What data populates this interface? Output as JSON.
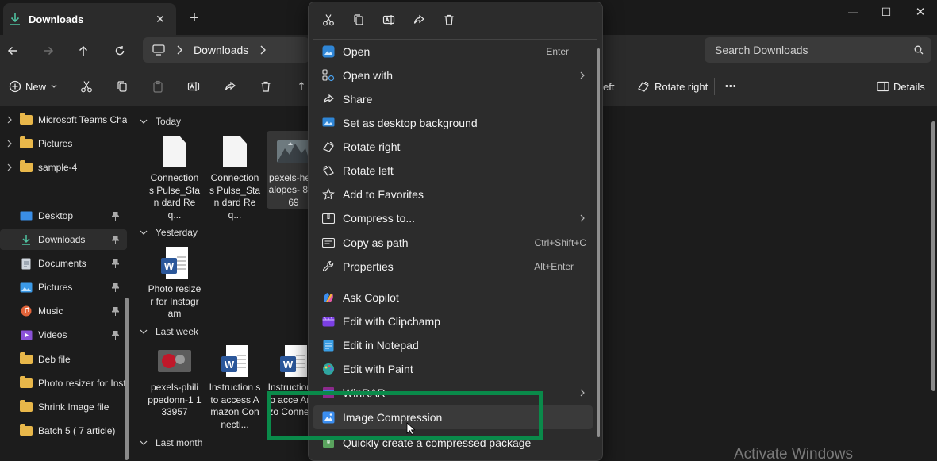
{
  "tab": {
    "title": "Downloads",
    "close": "✕",
    "new": "+"
  },
  "window_controls": {
    "minimize": "—",
    "maximize": "☐",
    "close": "✕"
  },
  "nav": {
    "breadcrumb": "Downloads",
    "search_placeholder": "Search Downloads"
  },
  "cmdbar": {
    "new_label": "New",
    "rotate_left_partial": "eft",
    "rotate_right_label": "Rotate right",
    "more_label": "•••",
    "details_label": "Details"
  },
  "sidebar": {
    "tree": [
      {
        "label": "Microsoft Teams Cha"
      },
      {
        "label": "Pictures"
      },
      {
        "label": "sample-4"
      }
    ],
    "quick": [
      {
        "label": "Desktop",
        "icon": "desktop-icon",
        "pinned": true
      },
      {
        "label": "Downloads",
        "icon": "download-icon",
        "pinned": true,
        "selected": true
      },
      {
        "label": "Documents",
        "icon": "documents-icon",
        "pinned": true
      },
      {
        "label": "Pictures",
        "icon": "pictures-icon",
        "pinned": true
      },
      {
        "label": "Music",
        "icon": "music-icon",
        "pinned": true
      },
      {
        "label": "Videos",
        "icon": "videos-icon",
        "pinned": true
      },
      {
        "label": "Deb file",
        "icon": "folder-icon",
        "pinned": false
      },
      {
        "label": "Photo resizer for Instag",
        "icon": "folder-icon",
        "pinned": false
      },
      {
        "label": "Shrink Image file",
        "icon": "folder-icon",
        "pinned": false
      },
      {
        "label": "Batch 5 ( 7 article)",
        "icon": "folder-icon",
        "pinned": false
      }
    ]
  },
  "groups": {
    "today": "Today",
    "yesterday": "Yesterday",
    "last_week": "Last week",
    "last_month": "Last month"
  },
  "files": {
    "today": [
      {
        "name": "Connection s Pulse_Stan dard Req..."
      },
      {
        "name": "Connection s Pulse_Stan dard Req..."
      },
      {
        "name": "pexels-he nalopes- 88069"
      }
    ],
    "yesterday": [
      {
        "name": "Photo resizer for Instagram"
      }
    ],
    "last_week": [
      {
        "name": "pexels-phili ppedonn-1 133957"
      },
      {
        "name": "Instruction s to access Amazon Connecti..."
      },
      {
        "name": "Instruction s to acce Amazo Connecti"
      }
    ]
  },
  "context_menu": {
    "items": [
      {
        "label": "Open",
        "shortcut": "Enter",
        "icon": "photos-app-icon"
      },
      {
        "label": "Open with",
        "submenu": true,
        "icon": "open-with-icon"
      },
      {
        "label": "Share",
        "icon": "share-icon"
      },
      {
        "label": "Set as desktop background",
        "icon": "desktop-background-icon"
      },
      {
        "label": "Rotate right",
        "icon": "rotate-right-icon"
      },
      {
        "label": "Rotate left",
        "icon": "rotate-left-icon"
      },
      {
        "label": "Add to Favorites",
        "icon": "star-icon"
      },
      {
        "label": "Compress to...",
        "submenu": true,
        "icon": "zip-icon"
      },
      {
        "label": "Copy as path",
        "shortcut": "Ctrl+Shift+C",
        "icon": "copy-path-icon"
      },
      {
        "label": "Properties",
        "shortcut": "Alt+Enter",
        "icon": "wrench-icon"
      },
      {
        "label": "Ask Copilot",
        "icon": "copilot-icon"
      },
      {
        "label": "Edit with Clipchamp",
        "icon": "clipchamp-icon"
      },
      {
        "label": "Edit in Notepad",
        "icon": "notepad-icon"
      },
      {
        "label": "Edit with Paint",
        "icon": "paint-icon"
      },
      {
        "label": "WinRAR",
        "submenu": true,
        "icon": "winrar-icon"
      },
      {
        "label": "Image Compression",
        "icon": "image-compression-icon",
        "highlighted": true
      },
      {
        "label": "Quickly create a compressed package",
        "icon": "compressed-package-icon"
      }
    ]
  },
  "watermark": "Activate Windows",
  "colors": {
    "highlight_box": "#0a8a4a",
    "accent": "#4aa3f0"
  }
}
